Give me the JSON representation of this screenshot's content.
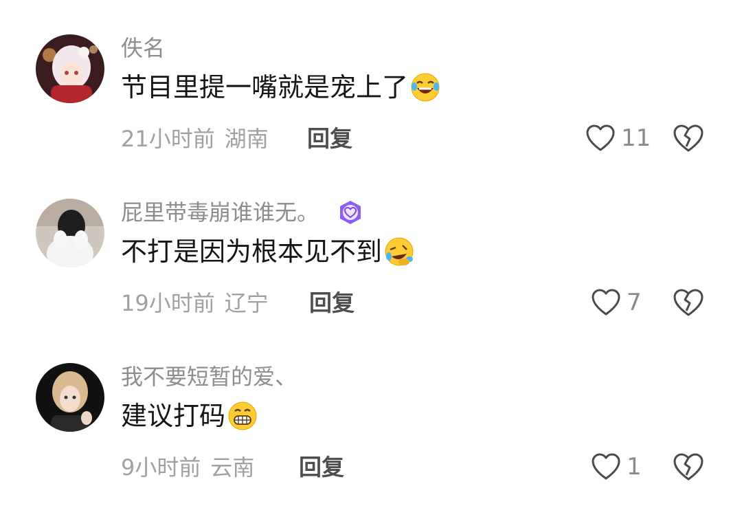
{
  "comments": [
    {
      "username": "佚名",
      "text": "节目里提一嘴就是宠上了",
      "emoji": "tears-of-joy-emoji",
      "time": "21小时前",
      "location": "湖南",
      "reply_label": "回复",
      "like_count": "11"
    },
    {
      "username": "屁里带毒崩谁谁无。",
      "text": "不打是因为根本见不到",
      "emoji": "rolling-laugh-emoji",
      "time": "19小时前",
      "location": "辽宁",
      "reply_label": "回复",
      "like_count": "7",
      "badge": "purple-heart-badge-icon"
    },
    {
      "username": "我不要短暂的爱、",
      "text": "建议打码",
      "emoji": "grinning-teeth-emoji",
      "time": "9小时前",
      "location": "云南",
      "reply_label": "回复",
      "like_count": "1"
    }
  ],
  "colors": {
    "username": "#8d8d8d",
    "meta": "#a0a0a0",
    "reply": "#4e4e4e",
    "badge": "#8b5cf6"
  }
}
